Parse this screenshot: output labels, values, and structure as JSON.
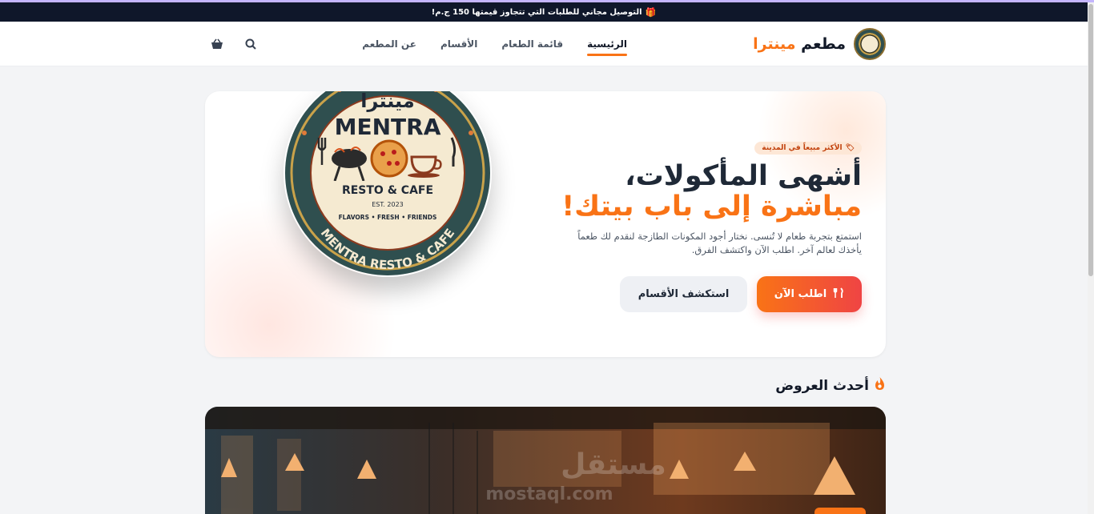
{
  "promo": {
    "text": "التوصيل مجاني للطلبات التي تتجاوز قيمتها 150 ج.م!"
  },
  "brand": {
    "name_main": "مطعم ",
    "name_accent": "مينترا"
  },
  "nav": {
    "items": [
      {
        "label": "الرئيسية",
        "active": true
      },
      {
        "label": "قائمة الطعام",
        "active": false
      },
      {
        "label": "الأقسام",
        "active": false
      },
      {
        "label": "عن المطعم",
        "active": false
      }
    ]
  },
  "icons": {
    "search": "search-icon",
    "cart": "basket-icon",
    "gift": "gift-icon",
    "utensils": "utensils-icon",
    "fire": "fire-icon"
  },
  "hero": {
    "badge": "الأكثر مبيعاً في المدينة",
    "title_line1": "أشهى المأكولات،",
    "title_line2": "مباشرة إلى باب بيتك!",
    "description": "استمتع بتجربة طعام لا تُنسى. نختار أجود المكونات الطازجة لنقدم لك طعماً يأخذك لعالم آخر. اطلب الآن واكتشف الفرق.",
    "cta_primary": "اطلب الآن",
    "cta_secondary": "استكشف الأقسام"
  },
  "logo": {
    "arabic": "مينترا",
    "title": "MENTRA",
    "subtitle": "RESTO & CAFE",
    "est": "EST. 2023",
    "tagline": "FLAVORS • FRESH • FRIENDS",
    "ring": "MENTRA RESTO & CAFE"
  },
  "offers": {
    "title": "أحدث العروض"
  },
  "watermark": {
    "text_ar": "مستقل",
    "text_en": "mostaql.com"
  },
  "colors": {
    "accent": "#f97316",
    "accent_red": "#ef4444",
    "dark": "#0f172a"
  }
}
